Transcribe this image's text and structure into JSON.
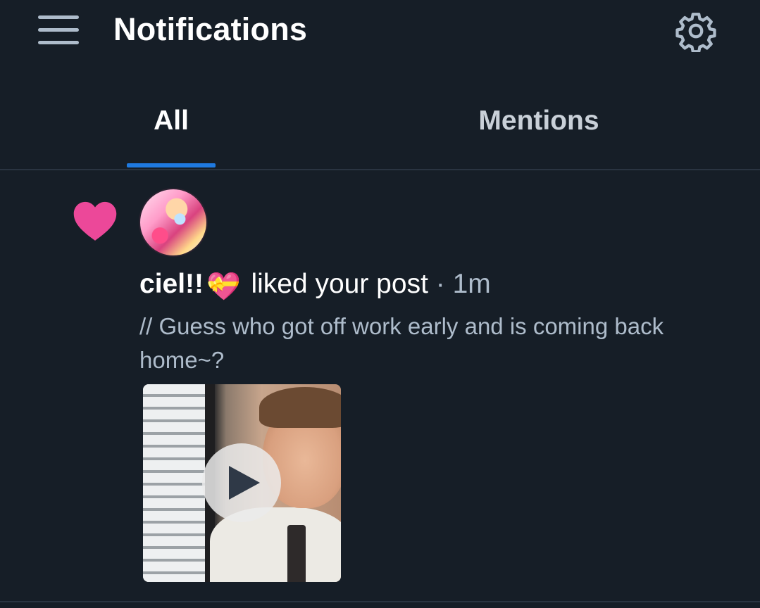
{
  "header": {
    "title": "Notifications",
    "menu_icon": "hamburger-menu-icon",
    "settings_icon": "gear-icon"
  },
  "tabs": [
    {
      "label": "All",
      "selected": true
    },
    {
      "label": "Mentions",
      "selected": false
    }
  ],
  "notification": {
    "type_icon": "heart-icon",
    "username": "ciel!!",
    "username_emoji": "💝",
    "action": "liked your post",
    "separator": "·",
    "time": "1m",
    "post_text": "// Guess who got off work early and is coming back home~?",
    "media": {
      "kind": "video",
      "play_icon": "play-icon"
    }
  },
  "colors": {
    "background": "#161e27",
    "accent": "#1f7ae0",
    "heart": "#ec4899",
    "muted_text": "#aebccb"
  }
}
